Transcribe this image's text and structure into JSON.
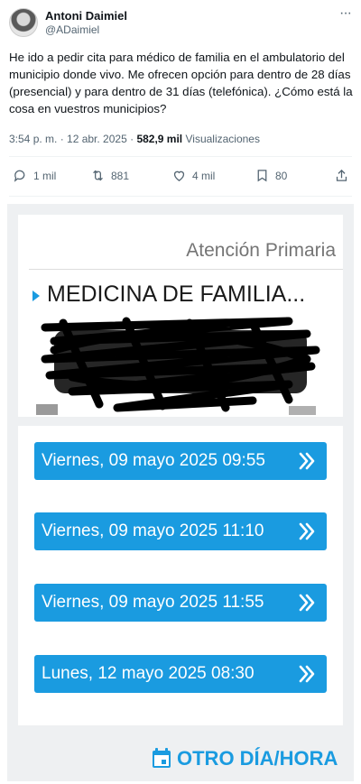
{
  "tweet": {
    "author_name": "Antoni Daimiel",
    "author_handle": "@ADaimiel",
    "more_label": "···",
    "text": "He ido a pedir cita para médico de familia en el ambulatorio del municipio donde vivo. Me ofrecen opción para dentro de 28 días (presencial) y para dentro de 31 días (telefónica). ¿Cómo está la cosa en vuestros municipios?",
    "time": "3:54 p. m. · 12 abr. 2025 ·",
    "views_count": "582,9 mil",
    "views_label": "Visualizaciones",
    "actions": {
      "replies": "1 mil",
      "retweets": "881",
      "likes": "4 mil",
      "bookmarks": "80"
    }
  },
  "screenshot": {
    "header_title": "Atención Primaria",
    "specialty": "MEDICINA DE FAMILIA...",
    "slots": [
      {
        "label": "Viernes, 09 mayo 2025 09:55"
      },
      {
        "label": "Viernes, 09 mayo 2025 11:10"
      },
      {
        "label": "Viernes, 09 mayo 2025 11:55"
      },
      {
        "label": "Lunes, 12 mayo 2025 08:30"
      }
    ],
    "other_button": "OTRO DÍA/HORA"
  },
  "colors": {
    "accent": "#1a9be0",
    "text_secondary": "#536471",
    "redaction": "#000000"
  },
  "icons": [
    "more-icon",
    "reply-icon",
    "retweet-icon",
    "like-icon",
    "bookmark-icon",
    "share-icon",
    "chevron-double-right-icon",
    "calendar-icon"
  ]
}
